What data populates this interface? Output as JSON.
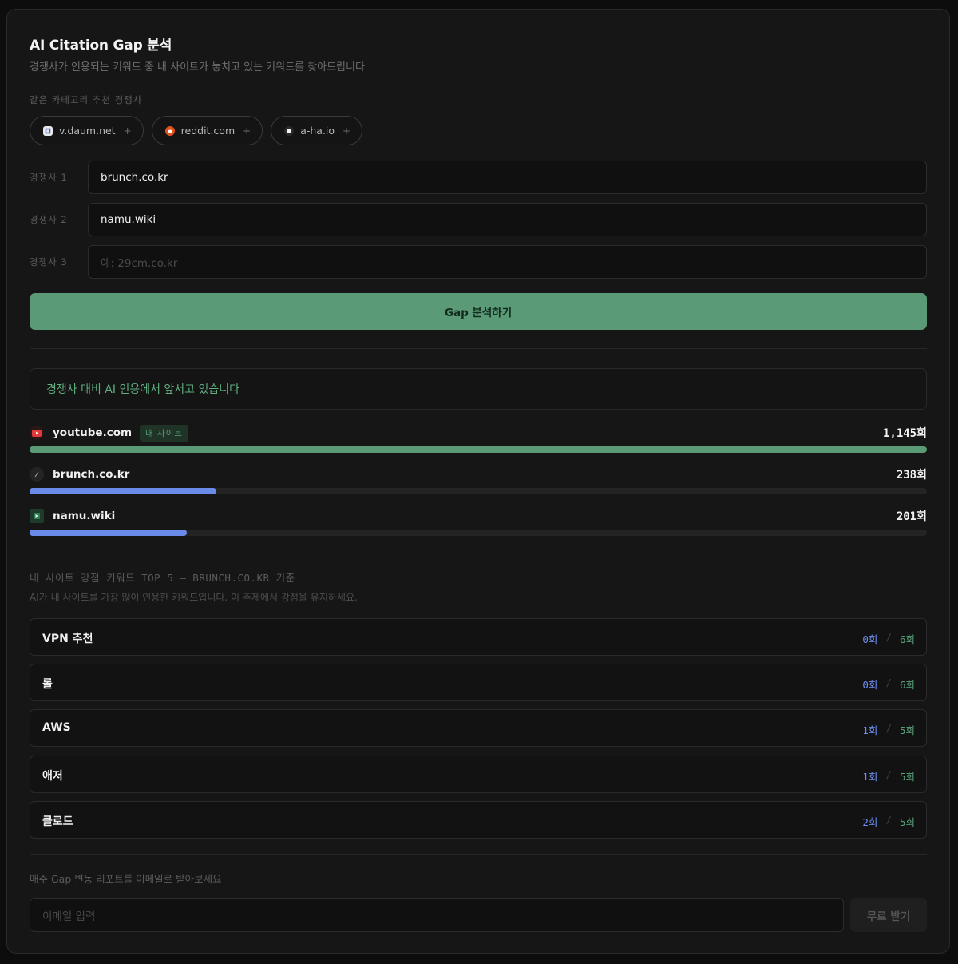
{
  "header": {
    "title": "AI Citation Gap 분석",
    "subtitle": "경쟁사가 인용되는 키워드 중 내 사이트가 놓치고 있는 키워드를 찾아드립니다"
  },
  "suggest": {
    "label": "같은 카테고리 추천 경쟁사",
    "chips": [
      {
        "domain": "v.daum.net",
        "plus": "+"
      },
      {
        "domain": "reddit.com",
        "plus": "+"
      },
      {
        "domain": "a-ha.io",
        "plus": "+"
      }
    ]
  },
  "competitors": [
    {
      "label": "경쟁사 1",
      "value": "brunch.co.kr",
      "placeholder": ""
    },
    {
      "label": "경쟁사 2",
      "value": "namu.wiki",
      "placeholder": ""
    },
    {
      "label": "경쟁사 3",
      "value": "",
      "placeholder": "예: 29cm.co.kr"
    }
  ],
  "analyze_button": "Gap 분석하기",
  "result_banner": "경쟁사 대비 AI 인용에서 앞서고 있습니다",
  "citations": [
    {
      "domain": "youtube.com",
      "badge": "내 사이트",
      "count": "1,145회",
      "value": 1145,
      "color": "#5a9a76"
    },
    {
      "domain": "brunch.co.kr",
      "badge": "",
      "count": "238회",
      "value": 238,
      "color": "#6a8be8"
    },
    {
      "domain": "namu.wiki",
      "badge": "",
      "count": "201회",
      "value": 201,
      "color": "#6a8be8"
    }
  ],
  "strength": {
    "title": "내 사이트 강점 키워드 TOP 5 — BRUNCH.CO.KR 기준",
    "desc": "AI가 내 사이트를 가장 많이 인용한 키워드입니다. 이 주제에서 강점을 유지하세요.",
    "keywords": [
      {
        "name": "VPN 추천",
        "mine": "0회",
        "sep": "/",
        "theirs": "6회"
      },
      {
        "name": "롤",
        "mine": "0회",
        "sep": "/",
        "theirs": "6회"
      },
      {
        "name": "AWS",
        "mine": "1회",
        "sep": "/",
        "theirs": "5회"
      },
      {
        "name": "애저",
        "mine": "1회",
        "sep": "/",
        "theirs": "5회"
      },
      {
        "name": "클로드",
        "mine": "2회",
        "sep": "/",
        "theirs": "5회"
      }
    ]
  },
  "email": {
    "label": "매주 Gap 변동 리포트를 이메일로 받아보세요",
    "placeholder": "이메일 입력",
    "button": "무료 받기"
  }
}
